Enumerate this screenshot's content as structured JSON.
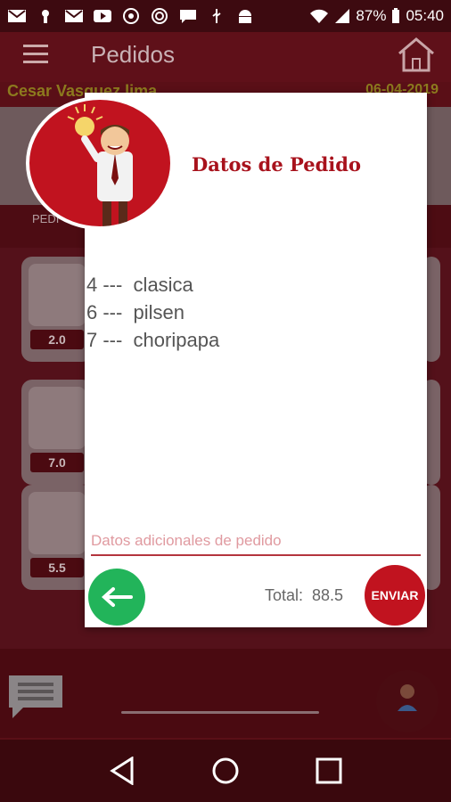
{
  "status_bar": {
    "battery": "87%",
    "time": "05:40",
    "icons": [
      "gmail-icon",
      "keyhole-icon",
      "gmail-icon",
      "youtube-icon",
      "chrome-icon",
      "target-icon",
      "message-icon",
      "usb-icon",
      "android-icon",
      "wifi-icon",
      "signal-icon",
      "battery-icon"
    ]
  },
  "app": {
    "title": "Pedidos",
    "user": "Cesar Vasquez  lima",
    "date": "06-04-2019",
    "tab_label": "PEDI",
    "products": [
      {
        "price": "2.0"
      },
      {
        "price": "7.0"
      },
      {
        "price": "5.5"
      }
    ]
  },
  "dialog": {
    "title": "Datos de Pedido",
    "items": [
      "4 ---  clasica",
      "6 ---  pilsen",
      "7 ---  choripapa"
    ],
    "notes_placeholder": "Datos adicionales de pedido",
    "total_label": "Total:  88.5",
    "send_label": "ENVIAR"
  },
  "colors": {
    "brand": "#c1131f",
    "back_button": "#22b45a",
    "background": "#5a0f17"
  }
}
